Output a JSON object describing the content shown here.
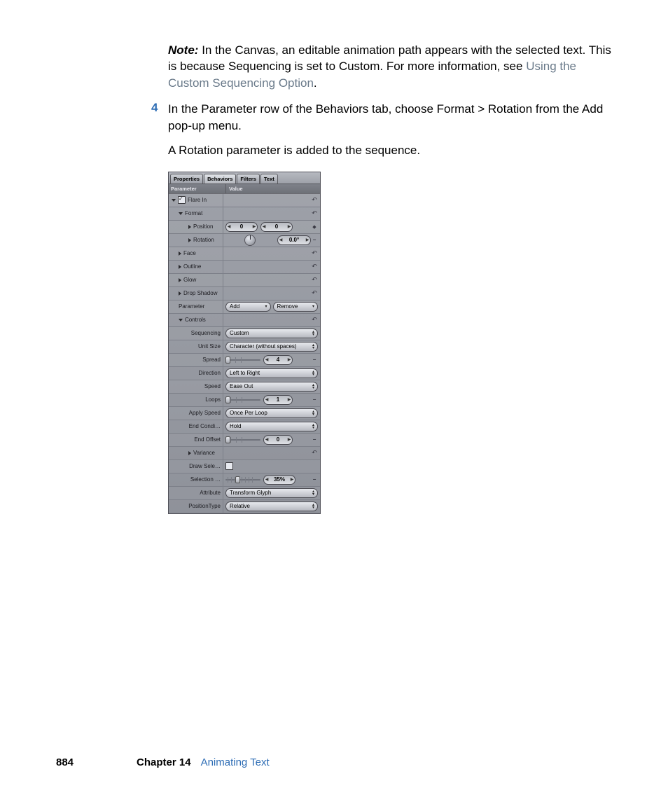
{
  "note": {
    "label": "Note:",
    "text_a": "In the Canvas, an editable animation path appears with the selected text. This is because Sequencing is set to Custom. For more information, see ",
    "link": "Using the Custom Sequencing Option",
    "text_b": "."
  },
  "step": {
    "num": "4",
    "text": "In the Parameter row of the Behaviors tab, choose Format > Rotation from the Add pop-up menu.",
    "follow": "A Rotation parameter is added to the sequence."
  },
  "panel": {
    "tabs": {
      "properties": "Properties",
      "behaviors": "Behaviors",
      "filters": "Filters",
      "text": "Text"
    },
    "header": {
      "param": "Parameter",
      "value": "Value"
    },
    "flare": "Flare In",
    "format": "Format",
    "position": {
      "label": "Position",
      "x": "0",
      "y": "0"
    },
    "rotation": {
      "label": "Rotation",
      "val": "0.0°"
    },
    "face": "Face",
    "outline": "Outline",
    "glow": "Glow",
    "dropshadow": "Drop Shadow",
    "paramrow": {
      "label": "Parameter",
      "add": "Add",
      "remove": "Remove"
    },
    "controls": "Controls",
    "sequencing": {
      "label": "Sequencing",
      "val": "Custom"
    },
    "unitsize": {
      "label": "Unit Size",
      "val": "Character (without spaces)"
    },
    "spread": {
      "label": "Spread",
      "val": "4"
    },
    "direction": {
      "label": "Direction",
      "val": "Left to Right"
    },
    "speed": {
      "label": "Speed",
      "val": "Ease Out"
    },
    "loops": {
      "label": "Loops",
      "val": "1"
    },
    "applyspeed": {
      "label": "Apply Speed",
      "val": "Once Per Loop"
    },
    "endcond": {
      "label": "End Condi…",
      "val": "Hold"
    },
    "endoffset": {
      "label": "End Offset",
      "val": "0"
    },
    "variance": {
      "label": "Variance"
    },
    "drawsele": {
      "label": "Draw Sele…"
    },
    "selection": {
      "label": "Selection …",
      "val": "35%"
    },
    "attribute": {
      "label": "Attribute",
      "val": "Transform Glyph"
    },
    "positiontype": {
      "label": "PositionType",
      "val": "Relative"
    }
  },
  "footer": {
    "page": "884",
    "chapter": "Chapter 14",
    "title": "Animating Text"
  }
}
